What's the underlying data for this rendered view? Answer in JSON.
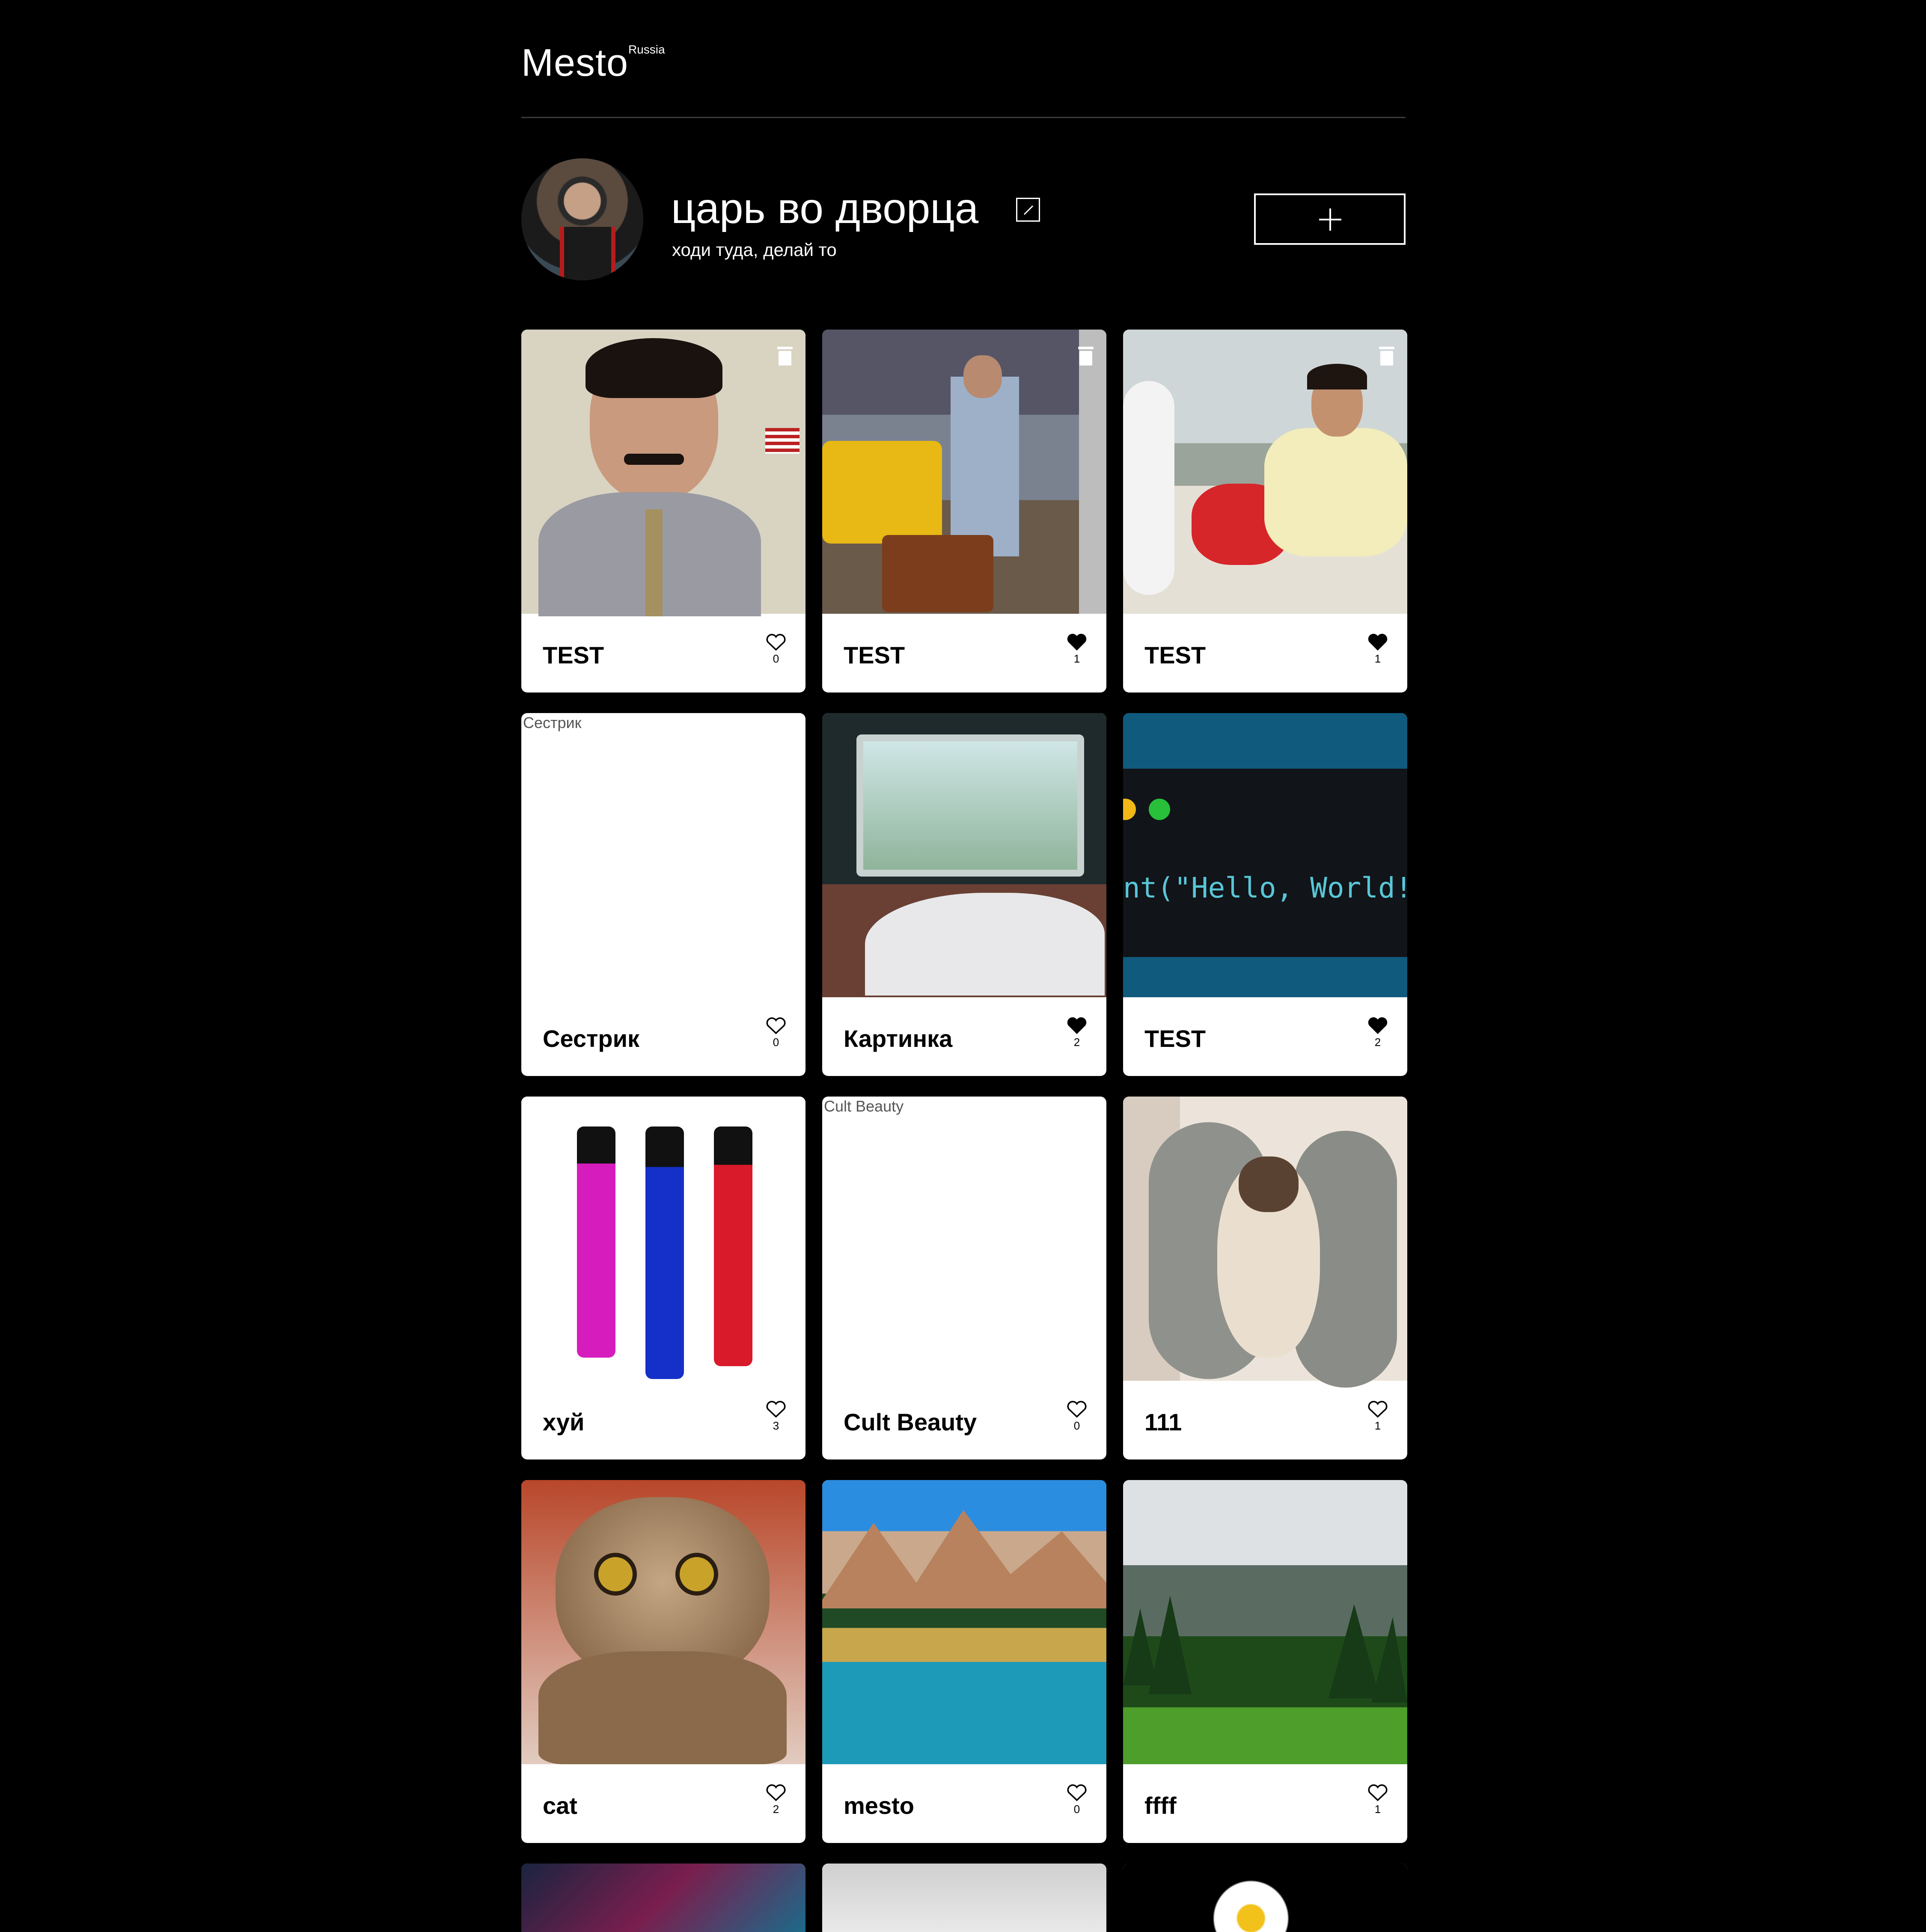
{
  "header": {
    "logo": "Mesto",
    "logo_sup": "Russia"
  },
  "profile": {
    "name": "царь во дворца",
    "about": "ходи туда, делай то"
  },
  "cards": [
    {
      "title": "TEST",
      "likes": "0",
      "liked": false,
      "deletable": true,
      "image": "man-with-flag",
      "alt": ""
    },
    {
      "title": "TEST",
      "likes": "1",
      "liked": true,
      "deletable": true,
      "image": "man-with-suitcases",
      "alt": ""
    },
    {
      "title": "TEST",
      "likes": "1",
      "liked": true,
      "deletable": true,
      "image": "man-lying",
      "alt": ""
    },
    {
      "title": "Сестрик",
      "likes": "0",
      "liked": false,
      "deletable": false,
      "image": "broken",
      "alt": "Сестрик"
    },
    {
      "title": "Картинка",
      "likes": "2",
      "liked": true,
      "deletable": false,
      "image": "tram-window",
      "alt": ""
    },
    {
      "title": "TEST",
      "likes": "2",
      "liked": true,
      "deletable": false,
      "image": "code-hello-world",
      "alt": "",
      "code_text": "nt(\"Hello, World!"
    },
    {
      "title": "хуй",
      "likes": "3",
      "liked": false,
      "deletable": false,
      "image": "vape-pens",
      "alt": ""
    },
    {
      "title": "Cult Beauty",
      "likes": "0",
      "liked": false,
      "deletable": false,
      "image": "broken",
      "alt": "Cult Beauty"
    },
    {
      "title": "111",
      "likes": "1",
      "liked": false,
      "deletable": false,
      "image": "siamese-cat",
      "alt": ""
    },
    {
      "title": "cat",
      "likes": "2",
      "liked": false,
      "deletable": false,
      "image": "tabby-cat",
      "alt": ""
    },
    {
      "title": "mesto",
      "likes": "0",
      "liked": false,
      "deletable": false,
      "image": "mountain-lake",
      "alt": ""
    },
    {
      "title": "ffff",
      "likes": "1",
      "liked": false,
      "deletable": false,
      "image": "mountain-forest",
      "alt": ""
    }
  ],
  "partial_cards": [
    "dragon",
    "grey",
    "daisy"
  ],
  "colors": {
    "background": "#000000",
    "card": "#ffffff",
    "text_dark": "#000000"
  }
}
